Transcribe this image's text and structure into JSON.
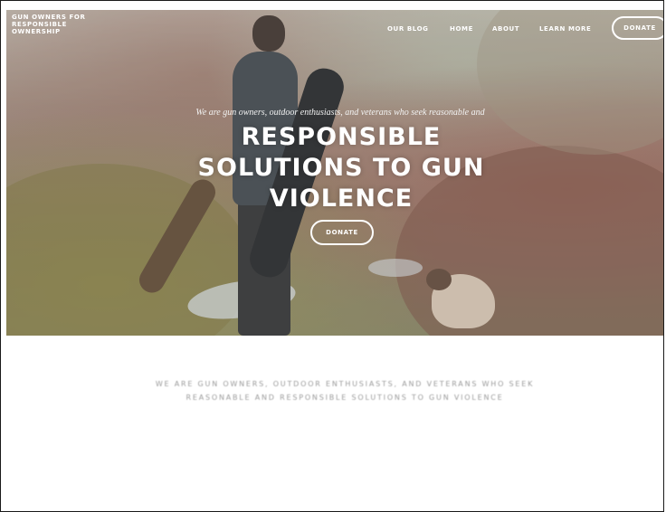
{
  "header": {
    "brand": "GUN OWNERS FOR RESPONSIBLE OWNERSHIP",
    "nav": [
      {
        "label": "OUR BLOG"
      },
      {
        "label": "HOME"
      },
      {
        "label": "ABOUT"
      },
      {
        "label": "LEARN MORE"
      }
    ],
    "donate_label": "DONATE"
  },
  "hero": {
    "kicker": "We are gun owners, outdoor enthusiasts, and veterans who seek reasonable and",
    "title": "RESPONSIBLE SOLUTIONS TO GUN VIOLENCE",
    "donate_label": "DONATE"
  },
  "intro": {
    "text": "WE ARE GUN OWNERS, OUTDOOR ENTHUSIASTS, AND VETERANS WHO SEEK REASONABLE AND RESPONSIBLE SOLUTIONS TO GUN VIOLENCE"
  },
  "colors": {
    "text_on_image": "#ffffff",
    "intro_text": "#9a9a9a",
    "background": "#ffffff"
  }
}
